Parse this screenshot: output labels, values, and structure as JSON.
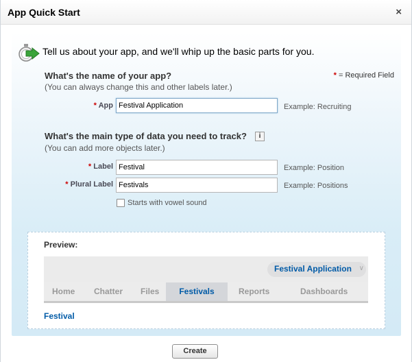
{
  "dialog": {
    "title": "App Quick Start",
    "close_icon": "close-icon",
    "close_glyph": "×"
  },
  "intro": {
    "text": "Tell us about your app, and we'll whip up the basic parts for you.",
    "icon": "app-wizard-icon"
  },
  "app_section": {
    "heading": "What's the name of your app?",
    "subtext": "(You can always change this and other labels later.)",
    "required_marker": "*",
    "required_note_text": "= Required Field"
  },
  "fields": {
    "app": {
      "required": "*",
      "label": "App",
      "value": "Festival Application",
      "example": "Example: Recruiting"
    },
    "label": {
      "required": "*",
      "label": "Label",
      "value": "Festival",
      "example": "Example: Position"
    },
    "plural_label": {
      "required": "*",
      "label": "Plural Label",
      "value": "Festivals",
      "example": "Example: Positions"
    },
    "vowel_checkbox": {
      "label": "Starts with vowel sound",
      "checked": false
    }
  },
  "data_section": {
    "heading": "What's the main type of data you need to track?",
    "info_glyph": "i",
    "subtext": "(You can add more objects later.)"
  },
  "preview": {
    "title": "Preview:",
    "app_switcher": "Festival Application",
    "app_switcher_arrow": "∨",
    "tabs": [
      "Home",
      "Chatter",
      "Files",
      "Festivals",
      "Reports",
      "Dashboards"
    ],
    "active_tab": "Festivals",
    "link": "Festival"
  },
  "buttons": {
    "create": "Create"
  },
  "colors": {
    "link_blue": "#015ba7",
    "required_red": "#cc0000",
    "panel_blue": "#d9edf7"
  }
}
